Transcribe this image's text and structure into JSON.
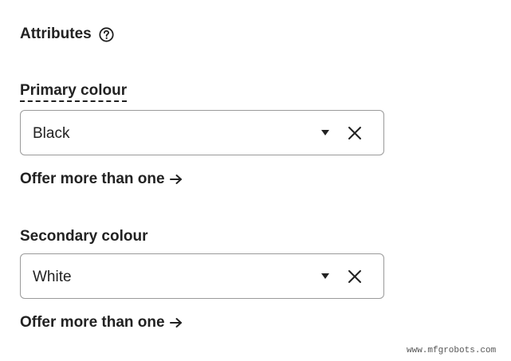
{
  "attributes": {
    "title": "Attributes",
    "help_icon": "question-circle-icon"
  },
  "primary": {
    "label": "Primary colour",
    "value": "Black",
    "caret_icon": "caret-down-icon",
    "clear_icon": "close-x-icon",
    "offer_text": "Offer more than one",
    "offer_icon": "arrow-right-icon"
  },
  "secondary": {
    "label": "Secondary colour",
    "value": "White",
    "caret_icon": "caret-down-icon",
    "clear_icon": "close-x-icon",
    "offer_text": "Offer more than one",
    "offer_icon": "arrow-right-icon"
  },
  "watermark": "www.mfgrobots.com",
  "colors": {
    "text": "#222222",
    "border": "#9a9a9a",
    "background": "#ffffff"
  }
}
